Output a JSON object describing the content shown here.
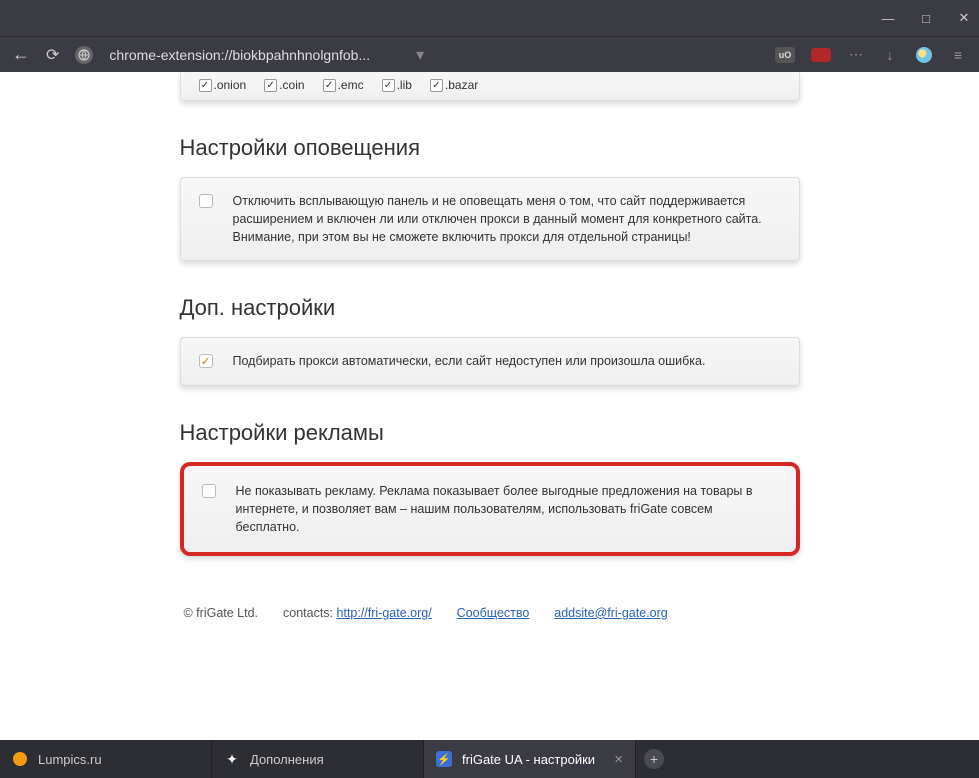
{
  "browser": {
    "url": "chrome-extension://biokbpahnhnolgnfob...",
    "window_controls": {
      "minimize": "—",
      "maximize": "□",
      "close": "✕"
    }
  },
  "tlds": {
    "items": [
      {
        "label": ".onion",
        "checked": true
      },
      {
        "label": ".coin",
        "checked": true
      },
      {
        "label": ".emc",
        "checked": true
      },
      {
        "label": ".lib",
        "checked": true
      },
      {
        "label": ".bazar",
        "checked": true
      }
    ]
  },
  "sections": {
    "notifications": {
      "title": "Настройки оповещения",
      "option_checked": false,
      "option_text": "Отключить всплывающую панель и не оповещать меня о том, что сайт поддерживается расширением и включен ли или отключен прокси в данный момент для конкретного сайта. Внимание, при этом вы не сможете включить прокси для отдельной страницы!"
    },
    "additional": {
      "title": "Доп. настройки",
      "option_checked": true,
      "option_text": "Подбирать прокси автоматически, если сайт недоступен или произошла ошибка."
    },
    "ads": {
      "title": "Настройки рекламы",
      "option_checked": false,
      "option_text": "Не показывать рекламу. Реклама показывает более выгодные предложения на товары в интернете, и позволяет вам – нашим пользователям, использовать friGate совсем бесплатно."
    }
  },
  "footer": {
    "copyright": "© friGate Ltd.",
    "contacts_label": "contacts:",
    "link1": "http://fri-gate.org/",
    "link2": "Сообщество",
    "link3": "addsite@fri-gate.org"
  },
  "tabs": {
    "items": [
      {
        "title": "Lumpics.ru",
        "active": false
      },
      {
        "title": "Дополнения",
        "active": false
      },
      {
        "title": "friGate UA - настройки",
        "active": true
      }
    ]
  }
}
